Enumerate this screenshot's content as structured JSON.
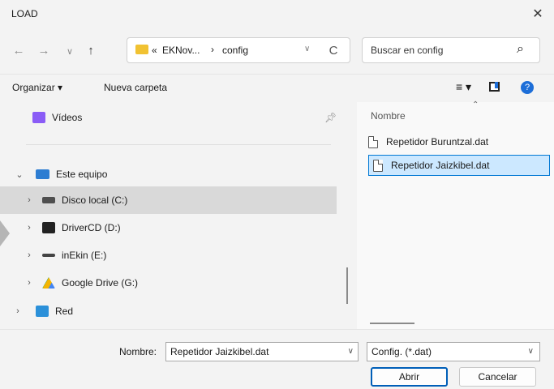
{
  "window": {
    "title": "LOAD",
    "close": "✕"
  },
  "nav": {
    "back": "←",
    "forward": "→",
    "recent": "∨",
    "up": "↑",
    "refresh": "C"
  },
  "address": {
    "prefix": "«",
    "path1": "EKNov...",
    "sep": "›",
    "path2": "config",
    "dropdown": "∨"
  },
  "search": {
    "placeholder": "Buscar en config",
    "icon": "⌕"
  },
  "toolbar": {
    "organize": "Organizar ▾",
    "new_folder": "Nueva carpeta",
    "view": "≡ ▾",
    "help": "?"
  },
  "sidebar": {
    "quick": [
      {
        "label": "Vídeos",
        "icon": "video-folder-icon",
        "color": "#8a5cf6"
      }
    ],
    "computer": {
      "label": "Este equipo",
      "color": "#2d7dd2"
    },
    "drives": [
      {
        "label": "Disco local (C:)",
        "icon": "drive-icon",
        "selected": true
      },
      {
        "label": "DriverCD (D:)",
        "icon": "cd-drive-icon"
      },
      {
        "label": "inEkin (E:)",
        "icon": "usb-drive-icon"
      },
      {
        "label": "Google Drive (G:)",
        "icon": "google-drive-icon"
      }
    ],
    "network": {
      "label": "Red",
      "color": "#2b90d9"
    }
  },
  "files": {
    "column": "Nombre",
    "items": [
      {
        "name": "Repetidor Buruntzal.dat",
        "selected": false
      },
      {
        "name": "Repetidor Jaizkibel.dat",
        "selected": true
      }
    ]
  },
  "footer": {
    "name_label": "Nombre:",
    "filename": "Repetidor Jaizkibel.dat",
    "filetype": "Config. (*.dat)",
    "open": "Abrir",
    "cancel": "Cancelar"
  },
  "colors": {
    "selected_bg": "#cce8ff",
    "accent": "#0078d4"
  }
}
